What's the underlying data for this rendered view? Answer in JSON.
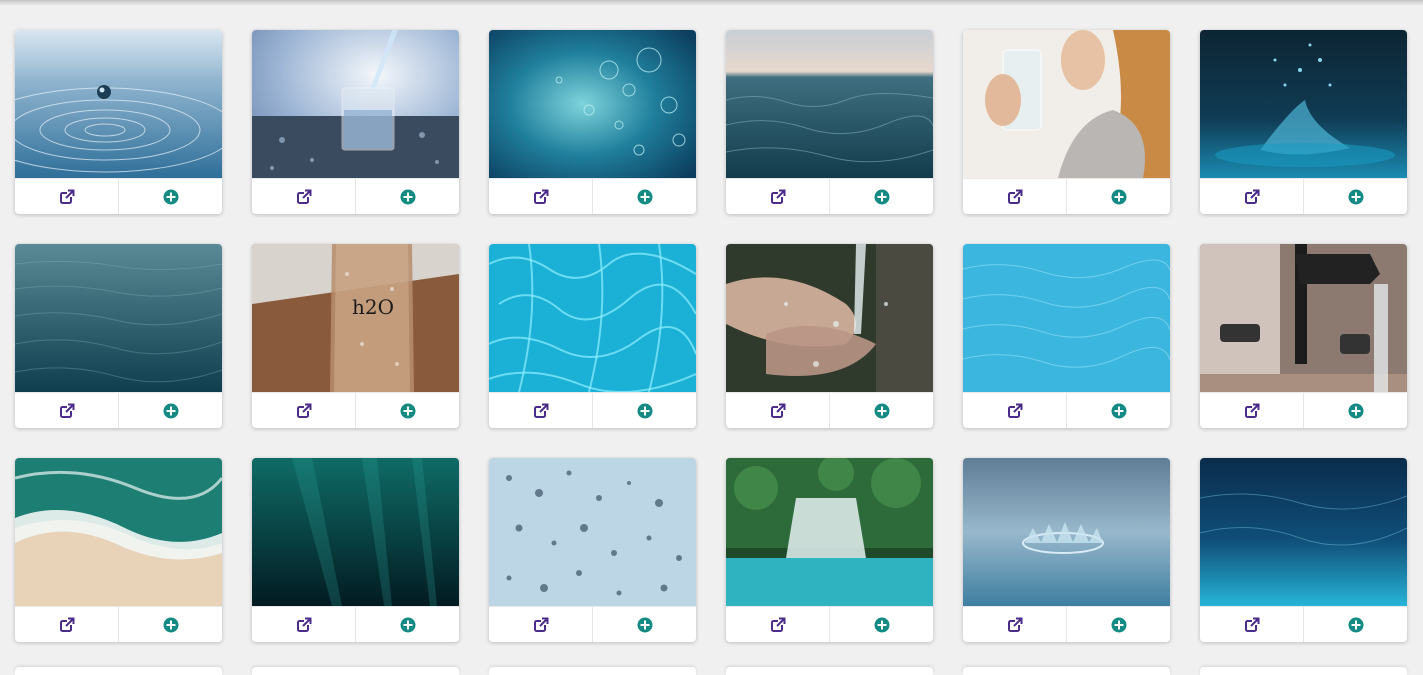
{
  "gallery": {
    "icons": {
      "open": "external-link-icon",
      "add": "plus-circle-icon"
    },
    "colors": {
      "open_icon": "#4c2c8a",
      "add_icon": "#138a83",
      "card_bg": "#ffffff",
      "page_bg": "#f0f0f1"
    },
    "items": [
      {
        "scene": "water-drop-ripple"
      },
      {
        "scene": "glass-being-filled"
      },
      {
        "scene": "underwater-bubbles"
      },
      {
        "scene": "ocean-surface-dusk"
      },
      {
        "scene": "woman-drinking-water"
      },
      {
        "scene": "water-splash-dark"
      },
      {
        "scene": "calm-sea-surface"
      },
      {
        "scene": "h2o-bottle"
      },
      {
        "scene": "pool-caustics"
      },
      {
        "scene": "hands-under-water-stream"
      },
      {
        "scene": "pool-water"
      },
      {
        "scene": "faucet-running"
      },
      {
        "scene": "aerial-beach-waves"
      },
      {
        "scene": "deep-underwater"
      },
      {
        "scene": "raindrops-on-glass"
      },
      {
        "scene": "tropical-waterfall"
      },
      {
        "scene": "water-crown-splash"
      },
      {
        "scene": "underwater-waves"
      }
    ]
  }
}
